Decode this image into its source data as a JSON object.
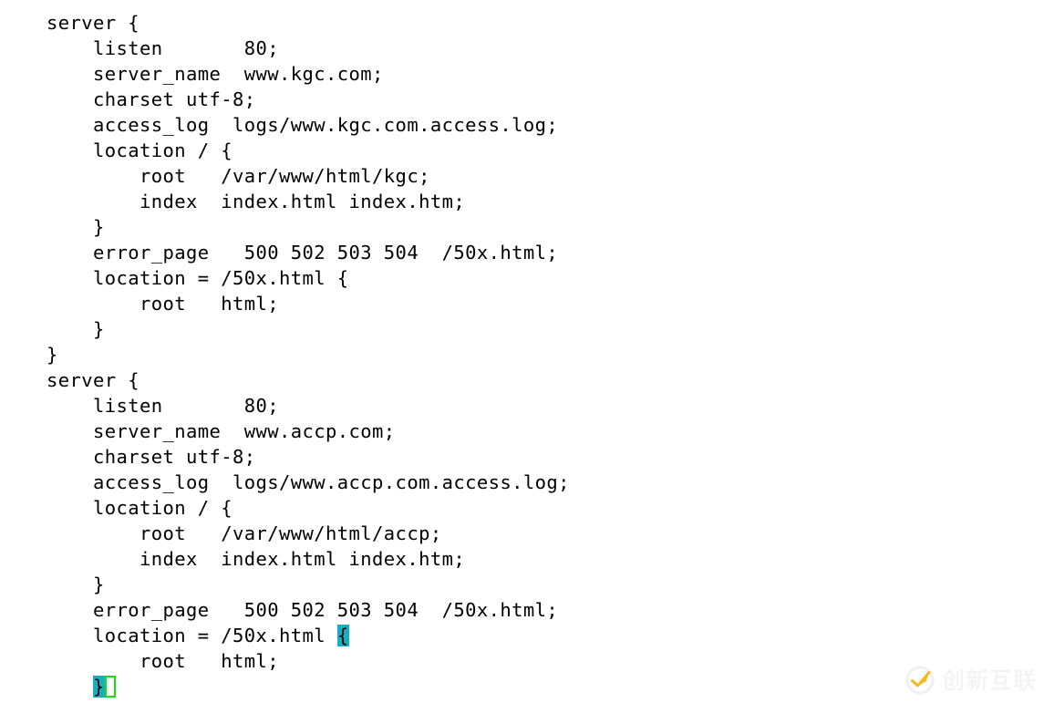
{
  "editor": {
    "background_color": "#ffffff",
    "text_color": "#000000",
    "highlight_color": "#17aec0",
    "cursor_color": "#12e012",
    "lines": [
      {
        "text": "server {"
      },
      {
        "text": "    listen       80;"
      },
      {
        "text": "    server_name  www.kgc.com;"
      },
      {
        "text": "    charset utf-8;"
      },
      {
        "text": "    access_log  logs/www.kgc.com.access.log;"
      },
      {
        "text": "    location / {"
      },
      {
        "text": "        root   /var/www/html/kgc;"
      },
      {
        "text": "        index  index.html index.htm;"
      },
      {
        "text": "    }"
      },
      {
        "text": "    error_page   500 502 503 504  /50x.html;"
      },
      {
        "text": "    location = /50x.html {"
      },
      {
        "text": "        root   html;"
      },
      {
        "text": "    }"
      },
      {
        "text": "}"
      },
      {
        "text": "server {"
      },
      {
        "text": "    listen       80;"
      },
      {
        "text": "    server_name  www.accp.com;"
      },
      {
        "text": "    charset utf-8;"
      },
      {
        "text": "    access_log  logs/www.accp.com.access.log;"
      },
      {
        "text": "    location / {"
      },
      {
        "text": "        root   /var/www/html/accp;"
      },
      {
        "text": "        index  index.html index.htm;"
      },
      {
        "text": "    }"
      },
      {
        "text": "    error_page   500 502 503 504  /50x.html;"
      },
      {
        "text": "    location = /50x.html ",
        "highlight": "{"
      },
      {
        "text": "        root   html;"
      },
      {
        "text": "    ",
        "highlight": "}",
        "cursor": true
      }
    ]
  },
  "watermark": {
    "label": "创新互联",
    "logo_icon": "circle-swoosh-logo-icon",
    "logo_color": "#f5b920",
    "text_color": "#f2f2f2"
  }
}
